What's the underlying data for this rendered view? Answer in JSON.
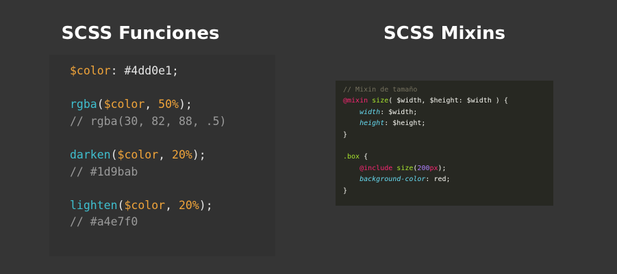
{
  "titles": {
    "left": "SCSS Funciones",
    "right": "SCSS Mixins"
  },
  "left_code": [
    [
      [
        "$color",
        "#f0a43a"
      ],
      [
        ": ",
        "#e6e6e6"
      ],
      [
        "#4dd0e1;",
        "#e6e6e6"
      ]
    ],
    [],
    [
      [
        "rgba",
        "#3fbfcf"
      ],
      [
        "(",
        "#e6e6e6"
      ],
      [
        "$color",
        "#f0a43a"
      ],
      [
        ", ",
        "#e6e6e6"
      ],
      [
        "50%",
        "#f0a43a"
      ],
      [
        ");",
        "#e6e6e6"
      ]
    ],
    [
      [
        "// rgba(30, 82, 88, .5)",
        "#9a9a9a"
      ]
    ],
    [],
    [
      [
        "darken",
        "#3fbfcf"
      ],
      [
        "(",
        "#e6e6e6"
      ],
      [
        "$color",
        "#f0a43a"
      ],
      [
        ", ",
        "#e6e6e6"
      ],
      [
        "20%",
        "#f0a43a"
      ],
      [
        ");",
        "#e6e6e6"
      ]
    ],
    [
      [
        "// #1d9bab",
        "#9a9a9a"
      ]
    ],
    [],
    [
      [
        "lighten",
        "#3fbfcf"
      ],
      [
        "(",
        "#e6e6e6"
      ],
      [
        "$color",
        "#f0a43a"
      ],
      [
        ", ",
        "#e6e6e6"
      ],
      [
        "20%",
        "#f0a43a"
      ],
      [
        ");",
        "#e6e6e6"
      ]
    ],
    [
      [
        "// #a4e7f0",
        "#9a9a9a"
      ]
    ]
  ],
  "right_code": [
    [
      [
        "// Mixin de tamaño",
        "#75715e"
      ]
    ],
    [
      [
        "@mixin",
        "#f92672"
      ],
      [
        " ",
        "#f8f8f2"
      ],
      [
        "size",
        "#a6e22e"
      ],
      [
        "( $width, $height: $width ) {",
        "#f8f8f2"
      ]
    ],
    [
      [
        "    ",
        "#f8f8f2"
      ],
      [
        "width",
        "#66d9ef",
        "it"
      ],
      [
        ": $width;",
        "#f8f8f2"
      ]
    ],
    [
      [
        "    ",
        "#f8f8f2"
      ],
      [
        "height",
        "#66d9ef",
        "it"
      ],
      [
        ": $height;",
        "#f8f8f2"
      ]
    ],
    [
      [
        "}",
        "#f8f8f2"
      ]
    ],
    [],
    [
      [
        ".box",
        "#a6e22e"
      ],
      [
        " {",
        "#f8f8f2"
      ]
    ],
    [
      [
        "    ",
        "#f8f8f2"
      ],
      [
        "@include",
        "#f92672"
      ],
      [
        " ",
        "#f8f8f2"
      ],
      [
        "size",
        "#a6e22e"
      ],
      [
        "(",
        "#f8f8f2"
      ],
      [
        "200",
        "#ae81ff"
      ],
      [
        "px",
        "#f92672"
      ],
      [
        ");",
        "#f8f8f2"
      ]
    ],
    [
      [
        "    ",
        "#f8f8f2"
      ],
      [
        "background-color",
        "#66d9ef",
        "it"
      ],
      [
        ": red;",
        "#f8f8f2"
      ]
    ],
    [
      [
        "}",
        "#f8f8f2"
      ]
    ]
  ]
}
